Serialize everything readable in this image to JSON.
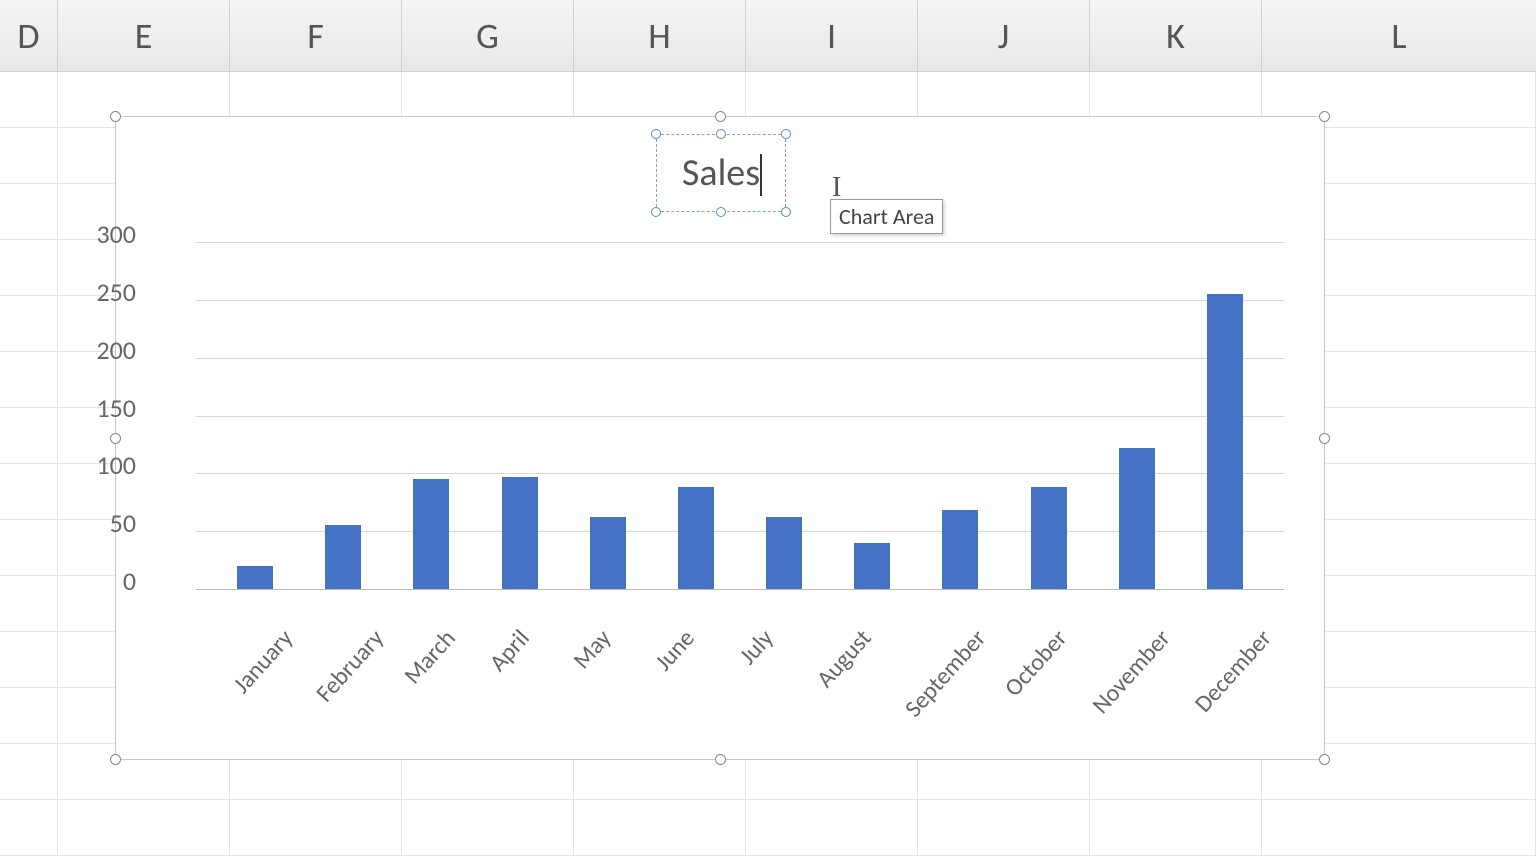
{
  "columns": [
    "D",
    "E",
    "F",
    "G",
    "H",
    "I",
    "J",
    "K",
    "L"
  ],
  "chart_title": "Sales",
  "tooltip_text": "Chart Area",
  "chart_data": {
    "type": "bar",
    "title": "Sales",
    "xlabel": "",
    "ylabel": "",
    "ylim": [
      0,
      300
    ],
    "y_ticks": [
      0,
      50,
      100,
      150,
      200,
      250,
      300
    ],
    "categories": [
      "January",
      "February",
      "March",
      "April",
      "May",
      "June",
      "July",
      "August",
      "September",
      "October",
      "November",
      "December"
    ],
    "values": [
      20,
      55,
      95,
      97,
      62,
      88,
      62,
      40,
      68,
      88,
      122,
      255
    ]
  },
  "colors": {
    "bar": "#4472C4",
    "gridline": "#d8d8d8",
    "text": "#666666",
    "title_selection": "#7aa8d0"
  }
}
